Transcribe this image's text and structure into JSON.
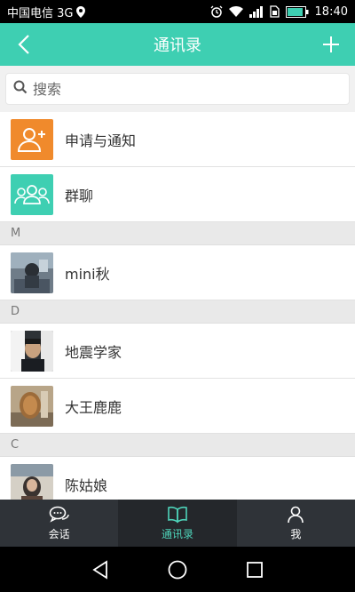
{
  "status": {
    "carrier": "中国电信 3G",
    "time": "18:40"
  },
  "topbar": {
    "title": "通讯录"
  },
  "search": {
    "placeholder": "搜索"
  },
  "special": {
    "requests_label": "申请与通知",
    "group_label": "群聊"
  },
  "sections": {
    "m": "M",
    "d": "D",
    "c": "C"
  },
  "contacts": {
    "mini": "mini秋",
    "dizhen": "地震学家",
    "dawang": "大王鹿鹿",
    "chen": "陈姑娘"
  },
  "tabs": {
    "chat": "会话",
    "contacts": "通讯录",
    "me": "我"
  },
  "colors": {
    "accent": "#3ecfb2",
    "orange": "#f08a2c",
    "active_tab_text": "#4ed4ba"
  }
}
